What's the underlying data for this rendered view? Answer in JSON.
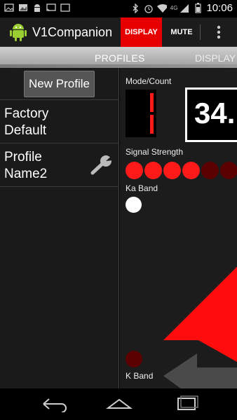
{
  "status_bar": {
    "time": "10:06",
    "network_type": "4G"
  },
  "action_bar": {
    "title": "V1Companion",
    "display_button": "DISPLAY",
    "mute_button": "MUTE"
  },
  "tabs": {
    "active": "PROFILES",
    "next": "DISPLAY"
  },
  "profiles": {
    "new_profile_button": "New Profile",
    "items": [
      {
        "line1": "Factory",
        "line2": "Default"
      },
      {
        "line1": "Profile",
        "line2": "Name2"
      }
    ]
  },
  "display": {
    "mode_count_label": "Mode/Count",
    "frequency": "34.",
    "signal_strength_label": "Signal Strength",
    "signal_strength": {
      "lit": 4,
      "total": 6
    },
    "ka_band_label": "Ka Band",
    "k_band_label": "K Band"
  },
  "colors": {
    "accent_red": "#e60000",
    "led_on": "#ff1a1a",
    "led_off": "#5a0000"
  }
}
